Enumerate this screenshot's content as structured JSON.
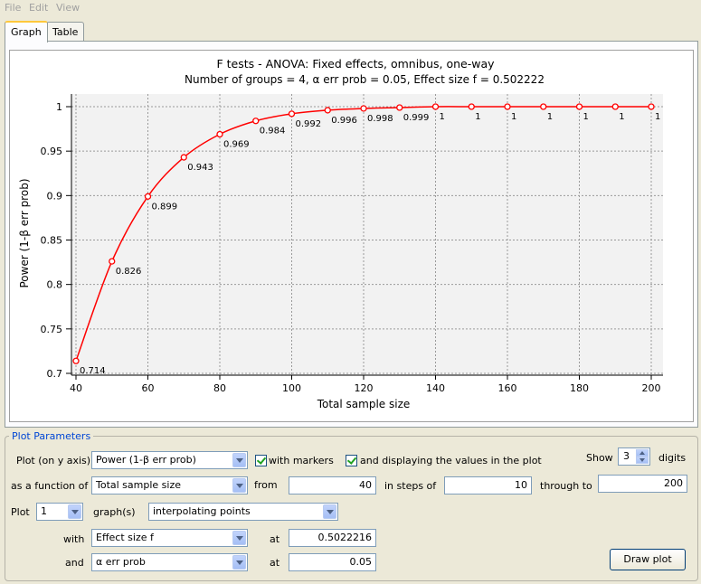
{
  "menu": [
    "File",
    "Edit",
    "View"
  ],
  "tabs": [
    "Graph",
    "Table"
  ],
  "chart_data": {
    "type": "line",
    "title": "F tests - ANOVA: Fixed effects, omnibus, one-way",
    "subtitle": "Number of groups = 4, α err prob = 0.05, Effect size f = 0.502222",
    "xlabel": "Total sample size",
    "ylabel": "Power (1-β err prob)",
    "x": [
      40,
      50,
      60,
      70,
      80,
      90,
      100,
      110,
      120,
      130,
      140,
      150,
      160,
      170,
      180,
      190,
      200
    ],
    "y": [
      0.714,
      0.826,
      0.899,
      0.943,
      0.969,
      0.984,
      0.992,
      0.996,
      0.998,
      0.999,
      1,
      1,
      1,
      1,
      1,
      1,
      1
    ],
    "labels": [
      "0.714",
      "0.826",
      "0.899",
      "0.943",
      "0.969",
      "0.984",
      "0.992",
      "0.996",
      "0.998",
      "0.999",
      "1",
      "1",
      "1",
      "1",
      "1",
      "1",
      "1"
    ],
    "xlim": [
      40,
      200
    ],
    "ylim": [
      0.7,
      1.0
    ],
    "xticks": [
      40,
      60,
      80,
      100,
      120,
      140,
      160,
      180,
      200
    ],
    "yticks": [
      0.7,
      0.75,
      0.8,
      0.85,
      0.9,
      0.95,
      1
    ],
    "ytick_labels": [
      "0.7",
      "0.75",
      "0.8",
      "0.85",
      "0.9",
      "0.95",
      "1"
    ],
    "grid": true,
    "line_color": "#ff0000"
  },
  "params": {
    "group_label": "Plot Parameters",
    "plot_y_label": "Plot (on y axis)",
    "plot_y_value": "Power (1-β err prob)",
    "with_markers_label": "with markers",
    "display_values_label": "and displaying the values in the plot",
    "show_label": "Show",
    "digits_value": "3",
    "digits_label": "digits",
    "function_label": "as a function of",
    "function_value": "Total sample size",
    "from_label": "from",
    "from_value": "40",
    "steps_label": "in steps of",
    "steps_value": "10",
    "through_label": "through to",
    "through_value": "200",
    "plot_label": "Plot",
    "plot_count": "1",
    "graphs_label": "graph(s)",
    "interp_value": "interpolating points",
    "with_label": "with",
    "with_value": "Effect size f",
    "at_label_1": "at",
    "at_value_1": "0.5022216",
    "and_label": "and",
    "and_value": "α err prob",
    "at_label_2": "at",
    "at_value_2": "0.05",
    "draw_button": "Draw plot"
  }
}
